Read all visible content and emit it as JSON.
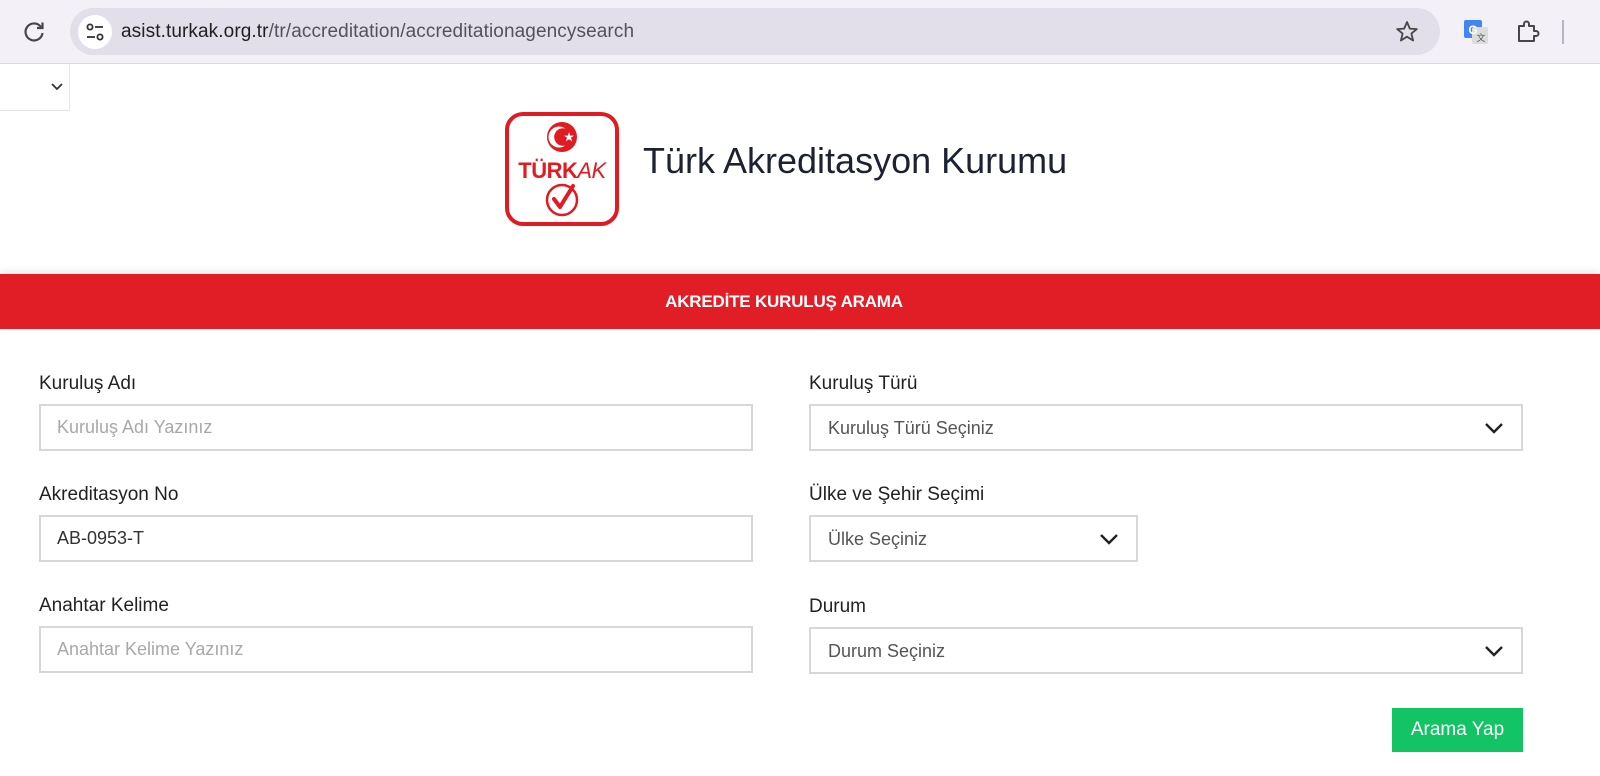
{
  "browser": {
    "url_host": "asist.turkak.org.tr",
    "url_path": "/tr/accreditation/accreditationagencysearch"
  },
  "header": {
    "logo": {
      "text_main": "TÜRK",
      "text_accent": "AK",
      "brand_color": "#e11b22"
    },
    "title": "Türk Akreditasyon Kurumu"
  },
  "banner": {
    "title": "AKREDİTE KURULUŞ ARAMA",
    "color": "#e11d26"
  },
  "form": {
    "kurulus_adi": {
      "label": "Kuruluş Adı",
      "placeholder": "Kuruluş Adı Yazınız",
      "value": ""
    },
    "akreditasyon_no": {
      "label": "Akreditasyon No",
      "placeholder": "",
      "value": "AB-0953-T"
    },
    "anahtar_kelime": {
      "label": "Anahtar Kelime",
      "placeholder": "Anahtar Kelime Yazınız",
      "value": ""
    },
    "kurulus_turu": {
      "label": "Kuruluş Türü",
      "selected": "Kuruluş Türü Seçiniz"
    },
    "ulke_sehir": {
      "label": "Ülke ve Şehir Seçimi",
      "selected": "Ülke Seçiniz"
    },
    "durum": {
      "label": "Durum",
      "selected": "Durum Seçiniz"
    },
    "submit_label": "Arama Yap",
    "submit_color": "#12c463"
  },
  "icons": {
    "reload": "reload-icon",
    "site_info": "tune-icon",
    "bookmark": "star-icon",
    "translate": "google-translate-icon",
    "extensions": "puzzle-icon",
    "dropdown": "chevron-down-icon"
  }
}
